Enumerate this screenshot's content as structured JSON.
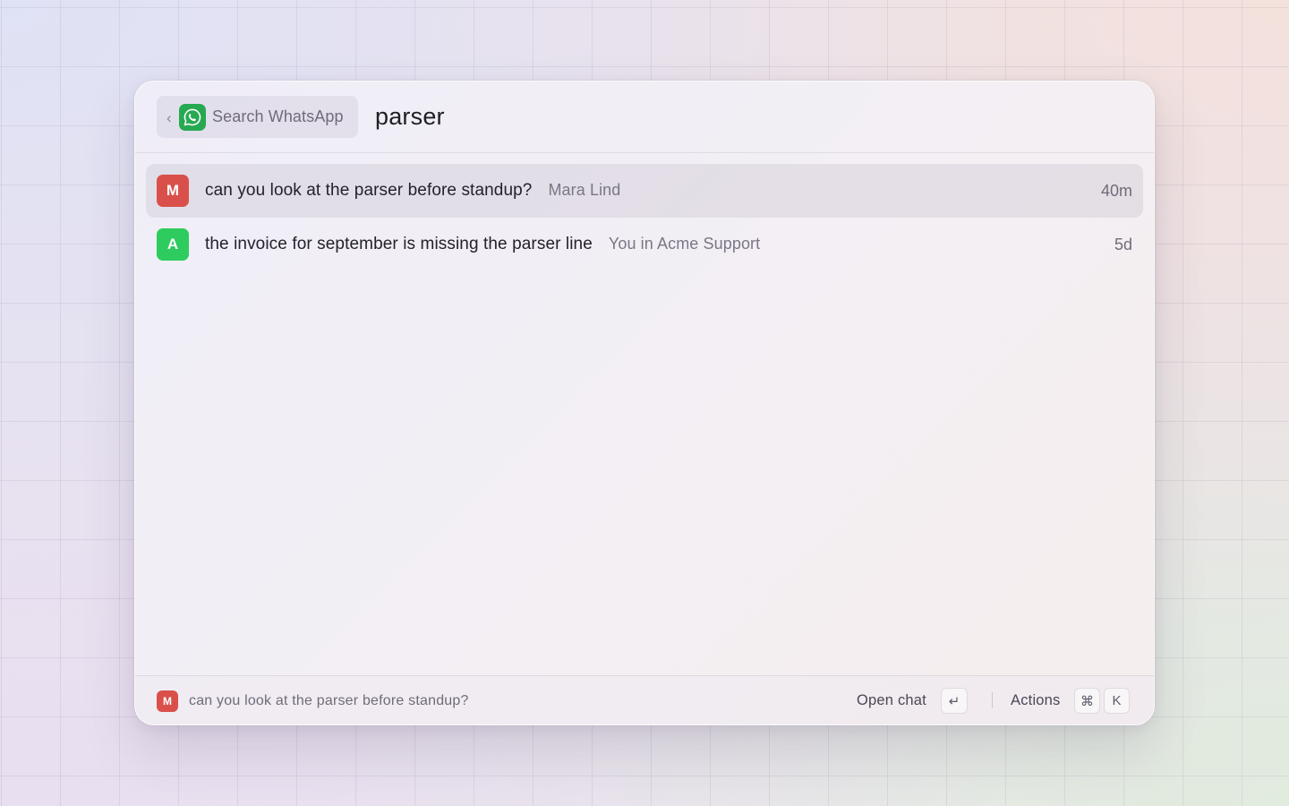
{
  "search": {
    "scope_label": "Search WhatsApp",
    "scope_icon": "whatsapp-icon",
    "back_icon": "chevron-left-icon",
    "query": "parser"
  },
  "results": [
    {
      "avatar_letter": "M",
      "avatar_color": "#d9504a",
      "title": "can you look at the parser before standup?",
      "subtitle": "Mara Lind",
      "time": "40m",
      "selected": true
    },
    {
      "avatar_letter": "A",
      "avatar_color": "#2ecc5e",
      "title": "the invoice for september is missing the parser line",
      "subtitle": "You in Acme Support",
      "time": "5d",
      "selected": false
    }
  ],
  "footer": {
    "avatar_letter": "M",
    "preview": "can you look at the parser before standup?",
    "primary_action": "Open chat",
    "primary_key": "↵",
    "actions_label": "Actions",
    "actions_keys": [
      "⌘",
      "K"
    ]
  },
  "colors": {
    "whatsapp_green": "#27a952",
    "selection": "#e4e0e8"
  }
}
